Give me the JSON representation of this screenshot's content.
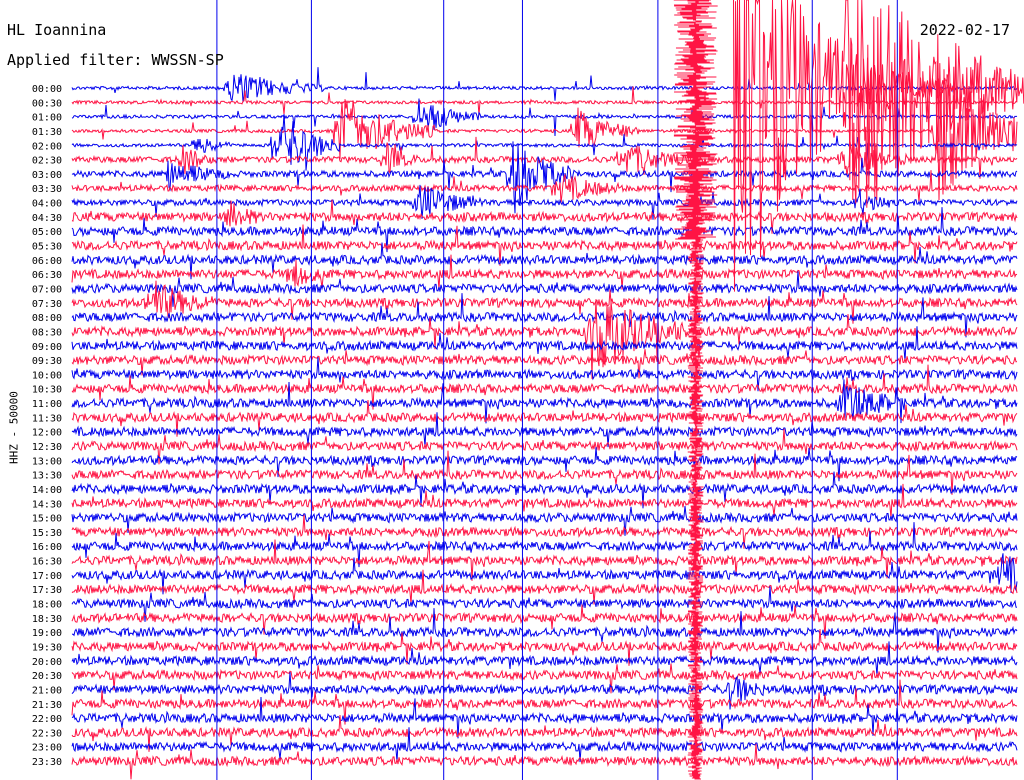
{
  "header": {
    "station": "HL Ioannina",
    "date": "2022-02-17",
    "filter": "Applied filter: WWSSN-SP"
  },
  "chart_data": {
    "type": "line",
    "title": "HL Ioannina",
    "channel_label": "HHZ - 50000",
    "colors": {
      "even_trace": "#0000ee",
      "odd_trace": "#ff1444",
      "minute_marker": "#0000ee"
    },
    "time_labels": [
      "00:00",
      "00:30",
      "01:00",
      "01:30",
      "02:00",
      "02:30",
      "03:00",
      "03:30",
      "04:00",
      "04:30",
      "05:00",
      "05:30",
      "06:00",
      "06:30",
      "07:00",
      "07:30",
      "08:00",
      "08:30",
      "09:00",
      "09:30",
      "10:00",
      "10:30",
      "11:00",
      "11:30",
      "12:00",
      "12:30",
      "13:00",
      "13:30",
      "14:00",
      "14:30",
      "15:00",
      "15:30",
      "16:00",
      "16:30",
      "17:00",
      "17:30",
      "18:00",
      "18:30",
      "19:00",
      "19:30",
      "20:00",
      "20:30",
      "21:00",
      "21:30",
      "22:00",
      "22:30",
      "23:00",
      "23:30"
    ],
    "events": [
      {
        "trace": 0,
        "minute": 5.0,
        "amplitude": 18,
        "duration": 3
      },
      {
        "trace": 2,
        "minute": 11.0,
        "amplitude": 20,
        "duration": 2
      },
      {
        "trace": 3,
        "minute": 8.5,
        "amplitude": 40,
        "duration": 3
      },
      {
        "trace": 3,
        "minute": 27.5,
        "amplitude": 70,
        "duration": 4
      },
      {
        "trace": 3,
        "minute": 16.0,
        "amplitude": 25,
        "duration": 2
      },
      {
        "trace": 4,
        "minute": 4.0,
        "amplitude": 12,
        "duration": 1
      },
      {
        "trace": 4,
        "minute": 6.5,
        "amplitude": 40,
        "duration": 2
      },
      {
        "trace": 5,
        "minute": 3.5,
        "amplitude": 14,
        "duration": 1
      },
      {
        "trace": 5,
        "minute": 10.0,
        "amplitude": 14,
        "duration": 1
      },
      {
        "trace": 5,
        "minute": 17.5,
        "amplitude": 18,
        "duration": 2
      },
      {
        "trace": 5,
        "minute": 24.5,
        "amplitude": 22,
        "duration": 2
      },
      {
        "trace": 6,
        "minute": 3.0,
        "amplitude": 15,
        "duration": 2
      },
      {
        "trace": 6,
        "minute": 14.0,
        "amplitude": 40,
        "duration": 2
      },
      {
        "trace": 7,
        "minute": 15.5,
        "amplitude": 14,
        "duration": 2
      },
      {
        "trace": 8,
        "minute": 11.0,
        "amplitude": 20,
        "duration": 2
      },
      {
        "trace": 8,
        "minute": 25.0,
        "amplitude": 15,
        "duration": 1
      },
      {
        "trace": 9,
        "minute": 5.0,
        "amplitude": 14,
        "duration": 1
      },
      {
        "trace": 13,
        "minute": 7.0,
        "amplitude": 14,
        "duration": 1
      },
      {
        "trace": 15,
        "minute": 2.5,
        "amplitude": 22,
        "duration": 2
      },
      {
        "trace": 17,
        "minute": 16.5,
        "amplitude": 45,
        "duration": 3
      },
      {
        "trace": 22,
        "minute": 24.5,
        "amplitude": 20,
        "duration": 2
      },
      {
        "trace": 27,
        "minute": 31.0,
        "amplitude": 28,
        "duration": 2
      },
      {
        "trace": 34,
        "minute": 29.5,
        "amplitude": 20,
        "duration": 2
      },
      {
        "trace": 41,
        "minute": 31.5,
        "amplitude": 25,
        "duration": 2
      },
      {
        "trace": 42,
        "minute": 21.0,
        "amplitude": 15,
        "duration": 1
      }
    ],
    "long_events": [
      {
        "trace": 0,
        "minute": 21.0,
        "amplitude": 260,
        "duration": 7.0
      },
      {
        "trace": 0,
        "minute": 24.5,
        "amplitude": 180,
        "duration": 9.0
      }
    ],
    "minute_markers": [
      4.6,
      7.6,
      11.8,
      14.3,
      18.6,
      23.5,
      26.2,
      31.8
    ]
  }
}
